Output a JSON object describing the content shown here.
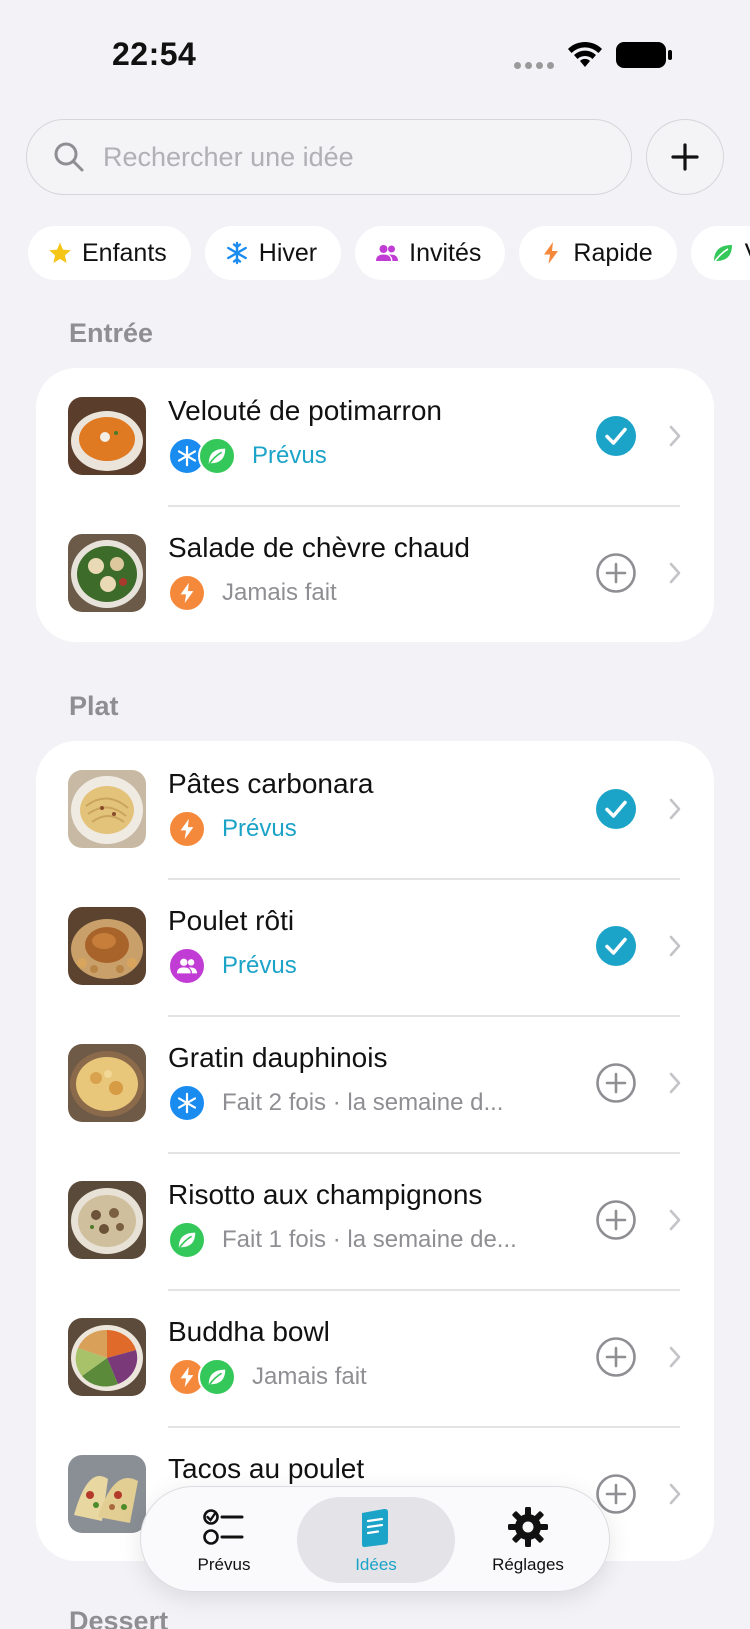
{
  "status_bar": {
    "time": "22:54"
  },
  "search": {
    "placeholder": "Rechercher une idée"
  },
  "filters": [
    {
      "label": "Enfants",
      "icon": "star-icon",
      "color": "#f5c518"
    },
    {
      "label": "Hiver",
      "icon": "snowflake-icon",
      "color": "#1a8cf0"
    },
    {
      "label": "Invités",
      "icon": "people-icon",
      "color": "#c13cd4"
    },
    {
      "label": "Rapide",
      "icon": "bolt-icon",
      "color": "#f5893b"
    },
    {
      "label": "V",
      "icon": "leaf-icon",
      "color": "#34c759"
    }
  ],
  "sections": [
    {
      "title": "Entrée",
      "items": [
        {
          "title": "Velouté de potimarron",
          "tags": [
            "snowflake-icon",
            "leaf-icon"
          ],
          "status": "Prévus",
          "planned": true
        },
        {
          "title": "Salade de chèvre chaud",
          "tags": [
            "bolt-icon"
          ],
          "status": "Jamais fait",
          "planned": false
        }
      ]
    },
    {
      "title": "Plat",
      "items": [
        {
          "title": "Pâtes carbonara",
          "tags": [
            "bolt-icon"
          ],
          "status": "Prévus",
          "planned": true
        },
        {
          "title": "Poulet rôti",
          "tags": [
            "people-icon"
          ],
          "status": "Prévus",
          "planned": true
        },
        {
          "title": "Gratin dauphinois",
          "tags": [
            "snowflake-icon"
          ],
          "status": "Fait 2 fois · la semaine d...",
          "planned": false
        },
        {
          "title": "Risotto aux champignons",
          "tags": [
            "leaf-icon"
          ],
          "status": "Fait 1 fois · la semaine de...",
          "planned": false
        },
        {
          "title": "Buddha bowl",
          "tags": [
            "bolt-icon",
            "leaf-icon"
          ],
          "status": "Jamais fait",
          "planned": false
        },
        {
          "title": "Tacos au poulet",
          "tags": [],
          "status": "",
          "planned": false
        }
      ]
    },
    {
      "title": "Dessert",
      "items": []
    }
  ],
  "tabbar": {
    "tabs": [
      {
        "label": "Prévus",
        "icon": "checklist-icon",
        "active": false
      },
      {
        "label": "Idées",
        "icon": "book-icon",
        "active": true
      },
      {
        "label": "Réglages",
        "icon": "gear-icon",
        "active": false
      }
    ]
  },
  "colors": {
    "accent": "#1ba3c8",
    "background": "#f2f2f7",
    "muted": "#8e8e93"
  }
}
